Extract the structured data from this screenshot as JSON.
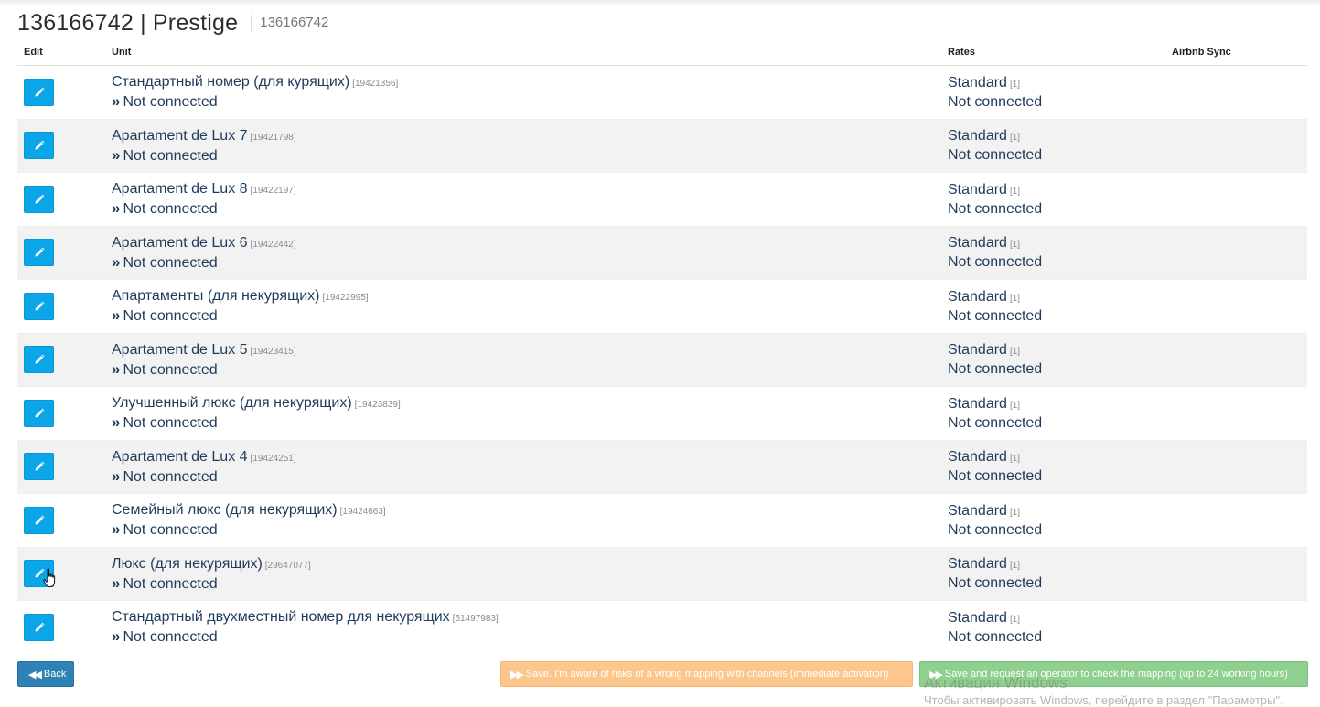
{
  "header": {
    "title": "136166742 | Prestige",
    "subtitle": "136166742"
  },
  "table": {
    "columns": {
      "edit": "Edit",
      "unit": "Unit",
      "rates": "Rates",
      "sync": "Airbnb Sync"
    },
    "rows": [
      {
        "unit": "Стандартный номер (для курящих)",
        "code": "[19421356]",
        "status": "Not connected",
        "rate": "Standard",
        "rate_code": "[1]",
        "rate_status": "Not connected"
      },
      {
        "unit": "Apartament de Lux 7",
        "code": "[19421798]",
        "status": "Not connected",
        "rate": "Standard",
        "rate_code": "[1]",
        "rate_status": "Not connected"
      },
      {
        "unit": "Apartament de Lux 8",
        "code": "[19422197]",
        "status": "Not connected",
        "rate": "Standard",
        "rate_code": "[1]",
        "rate_status": "Not connected"
      },
      {
        "unit": "Apartament de Lux 6",
        "code": "[19422442]",
        "status": "Not connected",
        "rate": "Standard",
        "rate_code": "[1]",
        "rate_status": "Not connected"
      },
      {
        "unit": "Апартаменты (для некурящих)",
        "code": "[19422995]",
        "status": "Not connected",
        "rate": "Standard",
        "rate_code": "[1]",
        "rate_status": "Not connected"
      },
      {
        "unit": "Apartament de Lux 5",
        "code": "[19423415]",
        "status": "Not connected",
        "rate": "Standard",
        "rate_code": "[1]",
        "rate_status": "Not connected"
      },
      {
        "unit": "Улучшенный люкс (для некурящих)",
        "code": "[19423839]",
        "status": "Not connected",
        "rate": "Standard",
        "rate_code": "[1]",
        "rate_status": "Not connected"
      },
      {
        "unit": "Apartament de Lux 4",
        "code": "[19424251]",
        "status": "Not connected",
        "rate": "Standard",
        "rate_code": "[1]",
        "rate_status": "Not connected"
      },
      {
        "unit": "Семейный люкс (для некурящих)",
        "code": "[19424663]",
        "status": "Not connected",
        "rate": "Standard",
        "rate_code": "[1]",
        "rate_status": "Not connected"
      },
      {
        "unit": "Люкс (для некурящих)",
        "code": "[29647077]",
        "status": "Not connected",
        "rate": "Standard",
        "rate_code": "[1]",
        "rate_status": "Not connected"
      },
      {
        "unit": "Стандартный двухместный номер для некурящих",
        "code": "[51497983]",
        "status": "Not connected",
        "rate": "Standard",
        "rate_code": "[1]",
        "rate_status": "Not connected"
      }
    ]
  },
  "footer": {
    "back_label": "Back",
    "save_now_label": "Save. I'm aware of risks of a wrong mapping with channels (immediate activation)",
    "save_check_label": "Save and request an operator to check the mapping (up to 24 working hours)"
  },
  "watermark": {
    "line1": "Активация Windows",
    "line2": "Чтобы активировать Windows, перейдите в раздел \"Параметры\"."
  },
  "colors": {
    "edit_button": "#0aa6e8",
    "back_button": "#2e82b5",
    "save_now_button": "#fcc68d",
    "save_check_button": "#8fcf8f",
    "link_text": "#1f3a5a",
    "striped_row": "#f2f2f2"
  },
  "icons": {
    "edit": "pencil-icon",
    "back": "double-chevron-left-icon",
    "save": "double-chevron-right-icon",
    "status": "double-chevron-right-icon",
    "cursor": "hand-pointer-icon"
  }
}
